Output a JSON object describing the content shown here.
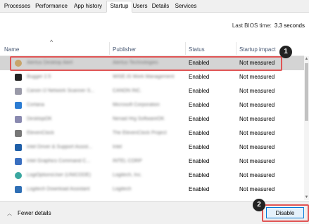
{
  "tabs": [
    {
      "label": "Processes",
      "active": false
    },
    {
      "label": "Performance",
      "active": false
    },
    {
      "label": "App history",
      "active": false
    },
    {
      "label": "Startup",
      "active": true
    },
    {
      "label": "Users",
      "active": false
    },
    {
      "label": "Details",
      "active": false
    },
    {
      "label": "Services",
      "active": false
    }
  ],
  "bios": {
    "label": "Last BIOS time:",
    "value": "3.3 seconds"
  },
  "columns": {
    "name": "Name",
    "publisher": "Publisher",
    "status": "Status",
    "impact": "Startup impact"
  },
  "rows": [
    {
      "name": "Alertus Desktop Alert",
      "publisher": "Alertus Technologies",
      "status": "Enabled",
      "impact": "Not measured",
      "icon": "app-icon",
      "color": "#c8a46a",
      "selected": true
    },
    {
      "name": "Bugger 2.5",
      "publisher": "WISE.IS Work Management",
      "status": "Enabled",
      "impact": "Not measured",
      "icon": "app-icon",
      "color": "#222222",
      "selected": false
    },
    {
      "name": "Canon IJ Network Scanner S...",
      "publisher": "CANON INC.",
      "status": "Enabled",
      "impact": "Not measured",
      "icon": "app-icon",
      "color": "#9a9aa8",
      "selected": false
    },
    {
      "name": "Cortana",
      "publisher": "Microsoft Corporation",
      "status": "Enabled",
      "impact": "Not measured",
      "icon": "app-icon",
      "color": "#2b7cd3",
      "selected": false
    },
    {
      "name": "DesktopOK",
      "publisher": "Nenad Hrg SoftwareOK",
      "status": "Enabled",
      "impact": "Not measured",
      "icon": "app-icon",
      "color": "#8a8ab0",
      "selected": false
    },
    {
      "name": "ElevenClock",
      "publisher": "The ElevenClock Project",
      "status": "Enabled",
      "impact": "Not measured",
      "icon": "app-icon",
      "color": "#777777",
      "selected": false
    },
    {
      "name": "Intel Driver & Support Assist...",
      "publisher": "Intel",
      "status": "Enabled",
      "impact": "Not measured",
      "icon": "app-icon",
      "color": "#1f5fa8",
      "selected": false
    },
    {
      "name": "Intel Graphics Command C...",
      "publisher": "INTEL CORP",
      "status": "Enabled",
      "impact": "Not measured",
      "icon": "app-icon",
      "color": "#3a6fc0",
      "selected": false
    },
    {
      "name": "LogiOptionsUser (UNICODE)",
      "publisher": "Logitech, Inc.",
      "status": "Enabled",
      "impact": "Not measured",
      "icon": "app-icon",
      "color": "#3aa7a0",
      "selected": false
    },
    {
      "name": "Logitech Download Assistant",
      "publisher": "Logitech",
      "status": "Enabled",
      "impact": "Not measured",
      "icon": "app-icon",
      "color": "#2f6fb5",
      "selected": false
    }
  ],
  "footer": {
    "fewer_details": "Fewer details",
    "disable": "Disable"
  },
  "annotations": [
    {
      "label": "1"
    },
    {
      "label": "2"
    }
  ]
}
